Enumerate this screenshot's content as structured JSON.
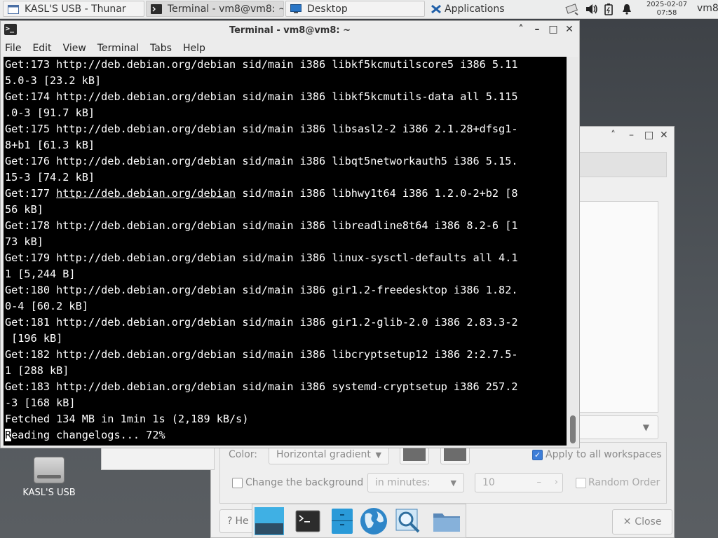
{
  "panel": {
    "tasks": [
      {
        "label": "KASL'S USB - Thunar",
        "icon": "folder-window-icon"
      },
      {
        "label": "Terminal - vm8@vm8: ~",
        "icon": "terminal-icon"
      },
      {
        "label": "Desktop",
        "icon": "desktop-icon"
      },
      {
        "label": "Applications",
        "icon": "xfce-mouse-icon"
      }
    ],
    "clock_date": "2025-02-07",
    "clock_time": "07:58",
    "user": "vm8"
  },
  "terminal": {
    "title": "Terminal - vm8@vm8: ~",
    "menu": [
      "File",
      "Edit",
      "View",
      "Terminal",
      "Tabs",
      "Help"
    ],
    "lines": [
      "Get:173 http://deb.debian.org/debian sid/main i386 libkf5kcmutilscore5 i386 5.11",
      "5.0-3 [23.2 kB]",
      "Get:174 http://deb.debian.org/debian sid/main i386 libkf5kcmutils-data all 5.115",
      ".0-3 [91.7 kB]",
      "Get:175 http://deb.debian.org/debian sid/main i386 libsasl2-2 i386 2.1.28+dfsg1-",
      "8+b1 [61.3 kB]",
      "Get:176 http://deb.debian.org/debian sid/main i386 libqt5networkauth5 i386 5.15.",
      "15-3 [74.2 kB]",
      "Get:177 ",
      "56 kB]",
      "Get:178 http://deb.debian.org/debian sid/main i386 libreadline8t64 i386 8.2-6 [1",
      "73 kB]",
      "Get:179 http://deb.debian.org/debian sid/main i386 linux-sysctl-defaults all 4.1",
      "1 [5,244 B]",
      "Get:180 http://deb.debian.org/debian sid/main i386 gir1.2-freedesktop i386 1.82.",
      "0-4 [60.2 kB]",
      "Get:181 http://deb.debian.org/debian sid/main i386 gir1.2-glib-2.0 i386 2.83.3-2",
      " [196 kB]",
      "Get:182 http://deb.debian.org/debian sid/main i386 libcryptsetup12 i386 2:2.7.5-",
      "1 [288 kB]",
      "Get:183 http://deb.debian.org/debian sid/main i386 systemd-cryptsetup i386 257.2",
      "-3 [168 kB]",
      "Fetched 134 MB in 1min 1s (2,189 kB/s)"
    ],
    "line177_link": "http://deb.debian.org/debian",
    "line177_rest": " sid/main i386 libhwy1t64 i386 1.2.0-2+b2 [8",
    "prompt_first_char": "R",
    "prompt_rest": "eading changelogs... 72%"
  },
  "background_dialog": {
    "color_label": "Color:",
    "color_mode": "Horizontal gradient",
    "apply_all": "Apply to all workspaces",
    "change_bg": "Change the background",
    "interval_unit": "in minutes:",
    "interval_value": "10",
    "random_order": "Random Order",
    "help": "He",
    "close": "Close",
    "colors": [
      "#6c6c6c",
      "#6c6c6c"
    ]
  },
  "desktop": {
    "icon_label": "KASL'S USB"
  },
  "dock": {
    "items": [
      "show-desktop-icon",
      "terminal-icon",
      "file-manager-icon",
      "web-browser-icon",
      "app-finder-icon",
      "folder-icon"
    ]
  }
}
